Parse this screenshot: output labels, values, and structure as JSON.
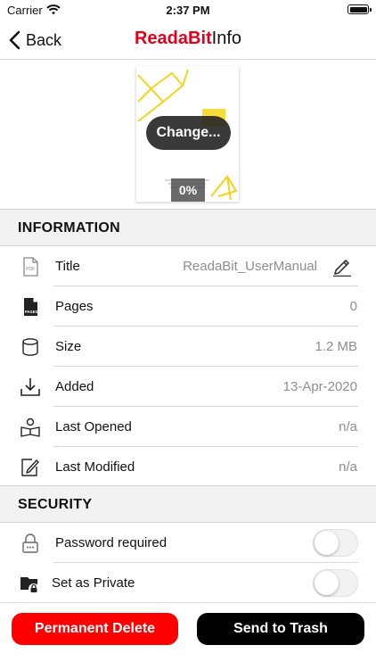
{
  "status_bar": {
    "carrier": "Carrier",
    "time": "2:37 PM"
  },
  "nav": {
    "back_label": "Back",
    "title_brand": "ReadaBit",
    "title_rest": "Info"
  },
  "cover": {
    "change_label": "Change...",
    "progress": "0%"
  },
  "information": {
    "header": "INFORMATION",
    "rows": [
      {
        "icon": "pdf-file-icon",
        "label": "Title",
        "value": "ReadaBit_UserManual"
      },
      {
        "icon": "pages-icon",
        "label": "Pages",
        "value": "0"
      },
      {
        "icon": "database-icon",
        "label": "Size",
        "value": "1.2 MB"
      },
      {
        "icon": "download-icon",
        "label": "Added",
        "value": "13-Apr-2020"
      },
      {
        "icon": "reader-icon",
        "label": "Last Opened",
        "value": "n/a"
      },
      {
        "icon": "edit-doc-icon",
        "label": "Last Modified",
        "value": "n/a"
      }
    ]
  },
  "security": {
    "header": "SECURITY",
    "rows": [
      {
        "icon": "lock-icon",
        "label": "Password required",
        "on": false
      },
      {
        "icon": "private-folder-icon",
        "label": "Set as Private",
        "on": false
      }
    ]
  },
  "actions": {
    "delete_label": "Permanent Delete",
    "trash_label": "Send to Trash"
  },
  "colors": {
    "brand": "#e0001b",
    "delete": "#ff0000",
    "trash": "#000000"
  }
}
